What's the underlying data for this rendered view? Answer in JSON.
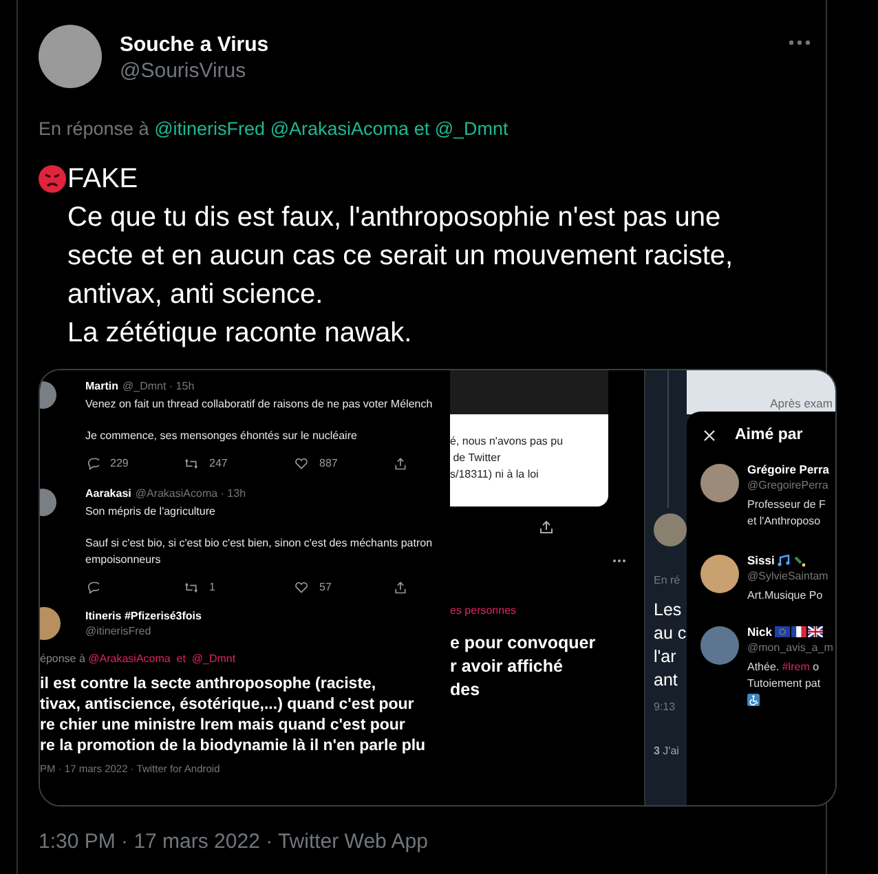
{
  "tweet": {
    "author": {
      "name": "Souche a Virus",
      "handle": "@SourisVirus"
    },
    "reply": {
      "label": "En réponse à",
      "mentions": [
        "@itinerisFred",
        "@ArakasiAcoma",
        "@_Dmnt"
      ],
      "joiner": "et"
    },
    "text": "FAKE\nCe que tu dis est faux, l'anthroposophie n'est pas une\nsecte et en aucun cas ce serait un mouvement raciste,\nantivax, anti science.\nLa zététique raconte nawak.",
    "media": {
      "thread": [
        {
          "name": "Martin",
          "handle": "@_Dmnt · 15h",
          "paragraphs": [
            "Venez on fait un thread collaboratif de raisons de ne pas voter Mélench",
            "Je commence, ses mensonges éhontés sur le nucléaire"
          ],
          "replies": "229",
          "retweets": "247",
          "likes": "887"
        },
        {
          "name": "Aarakasi",
          "handle": "@ArakasiAcoma · 13h",
          "paragraphs": [
            "Son mépris de l'agriculture",
            "Sauf si c'est bio, si c'est bio c'est bien, sinon c'est des méchants patron\nempoisonneurs"
          ],
          "retweets": "1",
          "likes": "57"
        }
      ],
      "focus": {
        "name": "Itineris #Pfizerisé3fois",
        "handle": "@itinerisFred",
        "reply_label": "éponse à",
        "mentions": "@ArakasiAcoma  et  @_Dmnt",
        "text": "il est contre la secte anthroposophe (raciste,\ntivax, antiscience, ésotérique,...) quand c'est pour\nre chier une ministre lrem mais quand c'est pour\nre la promotion de la biodynamie là il n'en parle plu",
        "meta": "PM · 17 mars 2022 · Twitter for Android"
      },
      "middle": {
        "notice": "é, nous n'avons pas pu\n de Twitter\ns/18311) ni à la loi",
        "mention_fragment": "es personnes",
        "text": "e pour convoquer\nr avoir affiché\ndes"
      },
      "dim": {
        "reply_fragment": "En ré",
        "text": "Les\nau c\nl'ar\nant",
        "time": "9:13",
        "likes_fragment": "**3** J'ai"
      },
      "top_strip": "Après exam",
      "likes": {
        "title": "Aimé par",
        "users": [
          {
            "name": "Grégoire Perra",
            "handle": "@GregoirePerra",
            "bio": "Professeur de F\net l'Anthroposo"
          },
          {
            "name": "Sissi",
            "handle": "@SylvieSaintam",
            "bio": "Art.Musique Po"
          },
          {
            "name": "Nick",
            "handle": "@mon_avis_a_m",
            "bio": "Athée. **#lrem** o\nTutoiement pat"
          }
        ]
      }
    },
    "meta": "1:30 PM · 17 mars 2022 · Twitter Web App"
  }
}
